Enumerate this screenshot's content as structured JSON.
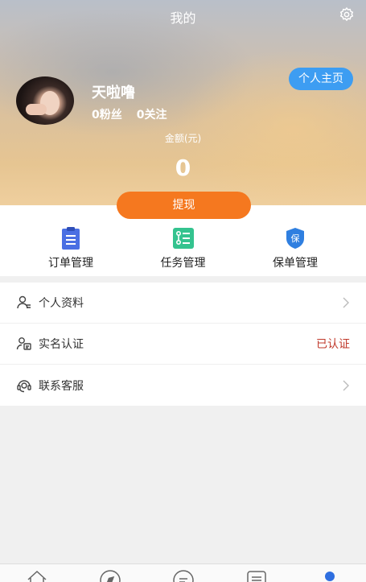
{
  "header": {
    "title": "我的",
    "home_button": "个人主页",
    "username": "天啦噜",
    "fans": "0粉丝",
    "following": "0关注",
    "amount_label": "金额(元)",
    "amount": "0",
    "withdraw": "提现"
  },
  "quick_actions": [
    {
      "label": "订单管理",
      "icon": "clipboard-icon",
      "color": "#4a6fe3"
    },
    {
      "label": "任务管理",
      "icon": "task-list-icon",
      "color": "#34c38f"
    },
    {
      "label": "保单管理",
      "icon": "shield-icon",
      "color": "#2f7fe0"
    }
  ],
  "menu": [
    {
      "label": "个人资料",
      "icon": "user-profile-icon",
      "trailing": "chevron"
    },
    {
      "label": "实名认证",
      "icon": "id-verify-icon",
      "status": "已认证"
    },
    {
      "label": "联系客服",
      "icon": "customer-service-icon",
      "trailing": "chevron"
    }
  ],
  "tabs": [
    {
      "icon": "home-icon"
    },
    {
      "icon": "compass-icon"
    },
    {
      "icon": "message-icon"
    },
    {
      "icon": "list-icon"
    },
    {
      "icon": "profile-icon",
      "active": true
    }
  ],
  "colors": {
    "accent_orange": "#f5781f",
    "accent_blue": "#3d9df2",
    "verified_red": "#c0392b"
  }
}
